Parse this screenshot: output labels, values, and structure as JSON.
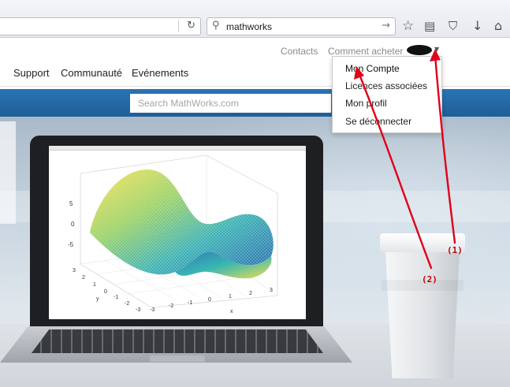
{
  "browser": {
    "search_value": "mathworks",
    "icons": [
      "reload-icon",
      "search-icon",
      "go-arrow-icon",
      "star-icon",
      "reading-list-icon",
      "pocket-icon",
      "download-icon",
      "home-icon"
    ]
  },
  "header": {
    "utility_links": [
      "Contacts",
      "Comment acheter"
    ],
    "main_nav": [
      "Support",
      "Communauté",
      "Evénements"
    ],
    "search_placeholder": "Search MathWorks.com"
  },
  "account_menu": {
    "items": [
      "Mon Compte",
      "Licences associées",
      "Mon profil",
      "Se déconnecter"
    ]
  },
  "plot": {
    "z_ticks": [
      "5",
      "0",
      "-5"
    ],
    "y_ticks": [
      "3",
      "2",
      "1",
      "0",
      "-1",
      "-2",
      "-3"
    ],
    "x_ticks": [
      "-3",
      "-2",
      "-1",
      "0",
      "1",
      "2",
      "3"
    ],
    "y_label": "y",
    "x_label": "x"
  },
  "annotations": {
    "label_1": "(1)",
    "label_2": "(2)",
    "color": "#e0001a"
  },
  "colors": {
    "band": "#2369a8",
    "annotation": "#e0001a"
  }
}
